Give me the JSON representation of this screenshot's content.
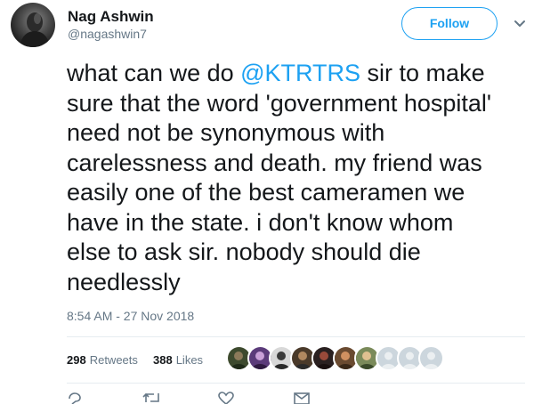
{
  "author": {
    "name": "Nag Ashwin",
    "handle": "@nagashwin7",
    "avatar_icon": "profile-photo"
  },
  "header": {
    "follow_label": "Follow",
    "menu_icon": "chevron-down-icon"
  },
  "tweet": {
    "segments": {
      "line1_pre": "what can we do ",
      "mention": "@KTRTRS",
      "line1_post": " sir to make",
      "line2": "sure that the word 'government hospital'",
      "line3": "need not be synonymous with",
      "line4": "carelessness and death. my friend was",
      "line5": "easily one of the best cameramen we",
      "line6": "have in the state. i don't know whom",
      "line7": "else to ask sir. nobody should die",
      "line8": "needlessly"
    },
    "timestamp": "8:54 AM - 27 Nov 2018"
  },
  "stats": {
    "retweets_count": "298",
    "retweets_label": "Retweets",
    "likes_count": "388",
    "likes_label": "Likes"
  },
  "likers": {
    "count_shown": 10,
    "colors": [
      "#4a5a3a",
      "#6a3d8a",
      "#3a3a3a",
      "#5a4a3a",
      "#2a2a2a",
      "#8a5a3a",
      "#7a6a4a",
      "#ccd6dd",
      "#ccd6dd",
      "#ccd6dd"
    ]
  },
  "colors": {
    "accent": "#1da1f2",
    "text": "#14171a",
    "muted": "#657786",
    "divider": "#e6ecf0"
  }
}
